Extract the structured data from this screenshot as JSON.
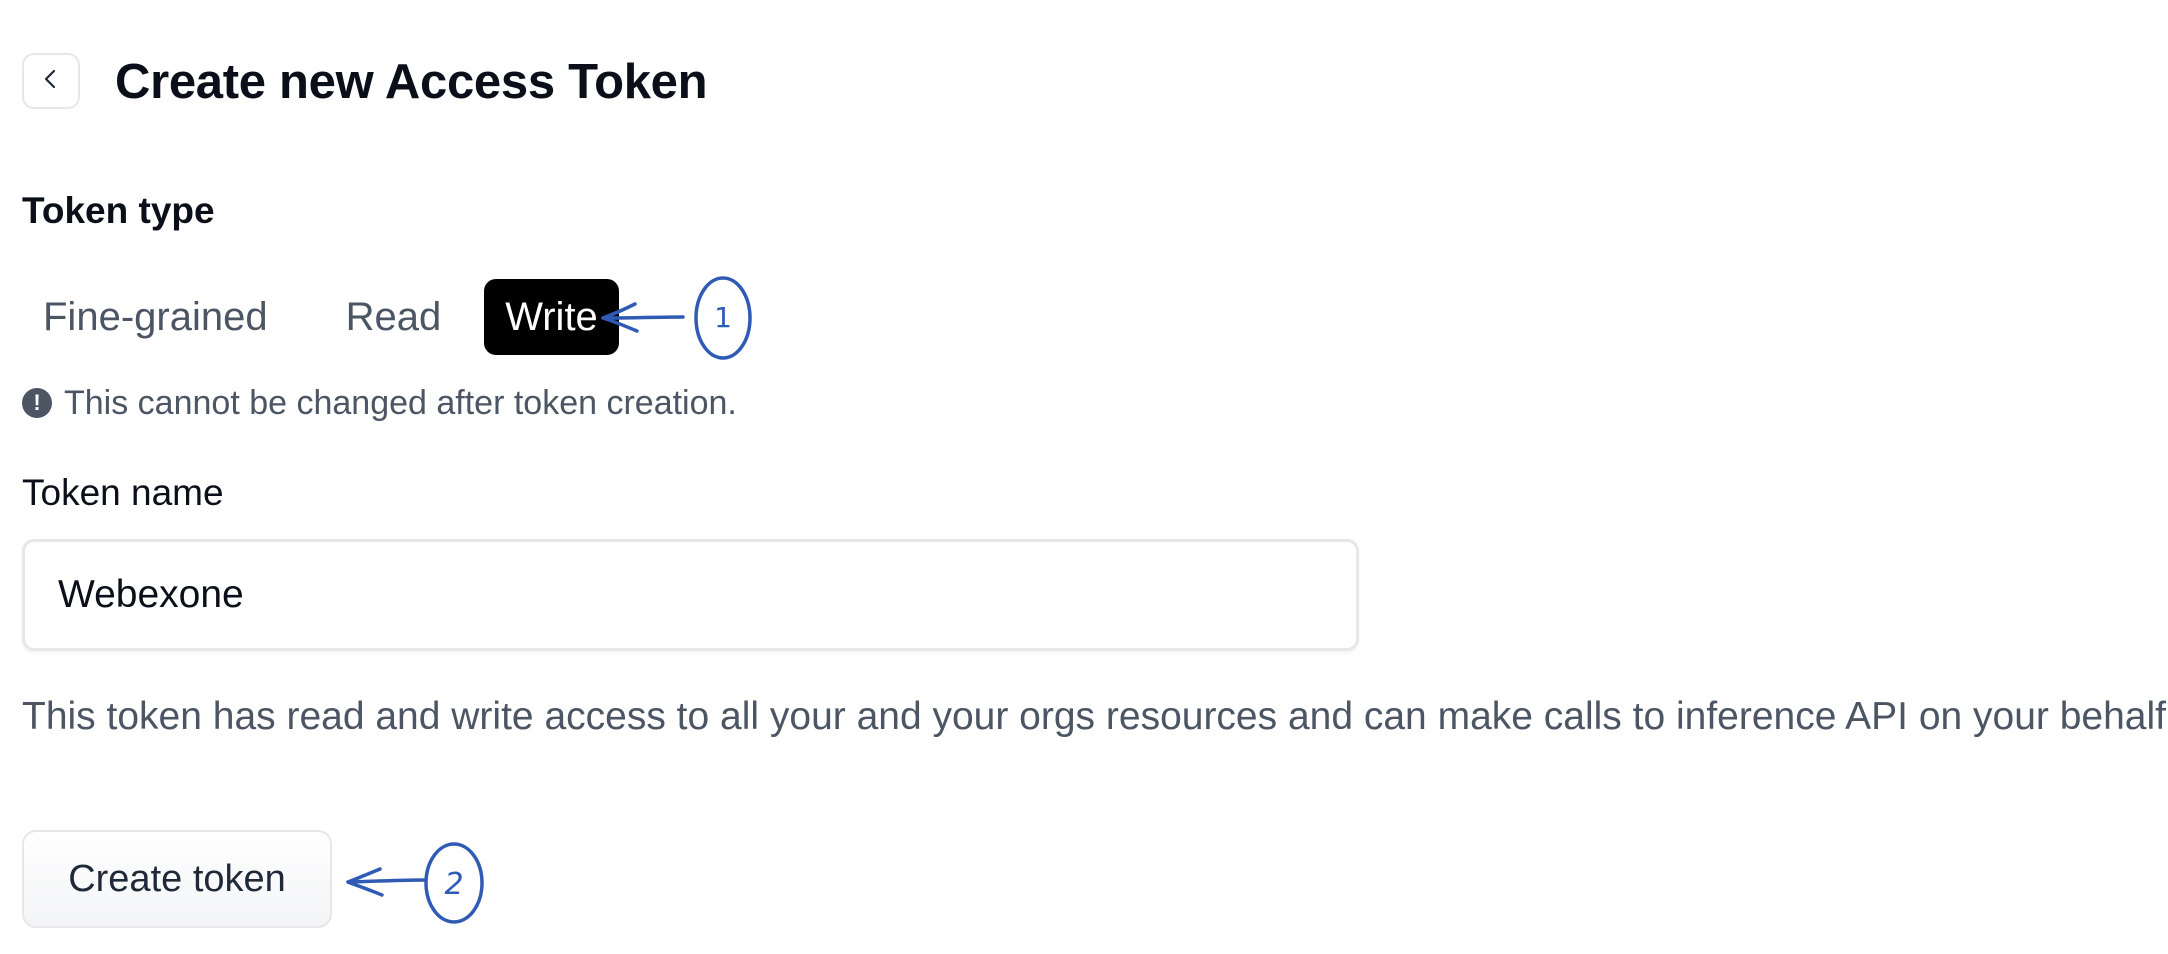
{
  "header": {
    "title": "Create new Access Token",
    "back_icon": "chevron-left-icon"
  },
  "token_type": {
    "label": "Token type",
    "options": [
      "Fine-grained",
      "Read",
      "Write"
    ],
    "selected": "Write",
    "notice_icon": "exclamation-circle-icon",
    "notice": "This cannot be changed after token creation."
  },
  "token_name": {
    "label": "Token name",
    "value": "Webexone"
  },
  "description": "This token has read and write access to all your and your orgs resources and can make calls to inference API on your behalf.",
  "actions": {
    "create_label": "Create token"
  },
  "annotations": {
    "marker_1": "1",
    "marker_2": "2",
    "color": "#2f5bb5"
  },
  "colors": {
    "selected_tab_bg": "#000000",
    "selected_tab_text": "#ffffff",
    "muted_text": "#4b5563"
  }
}
